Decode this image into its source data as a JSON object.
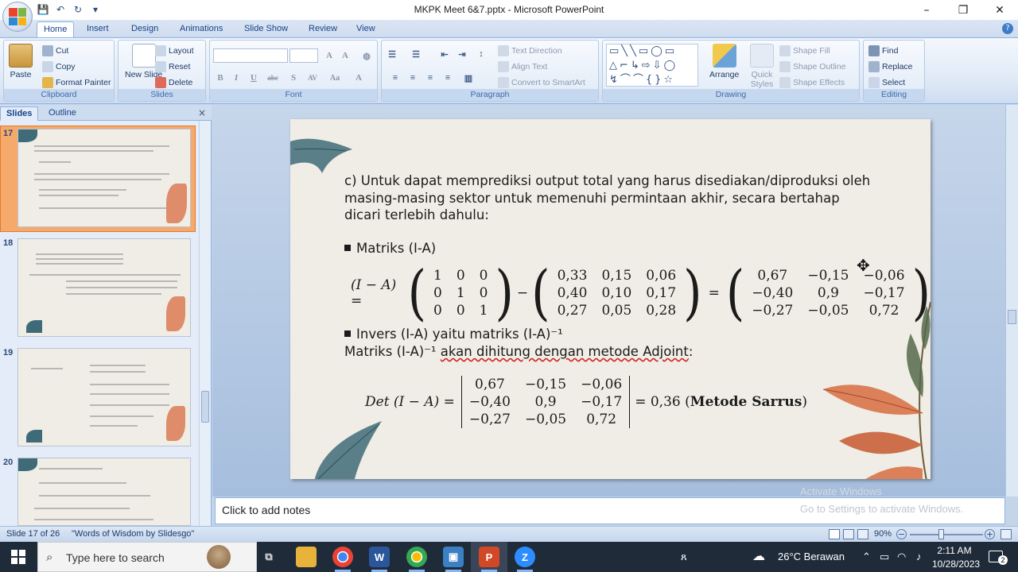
{
  "window": {
    "title": "MKPK Meet 6&7.pptx - Microsoft PowerPoint"
  },
  "tabs": [
    "Home",
    "Insert",
    "Design",
    "Animations",
    "Slide Show",
    "Review",
    "View"
  ],
  "ribbon": {
    "clipboard": {
      "label": "Clipboard",
      "paste": "Paste",
      "cut": "Cut",
      "copy": "Copy",
      "format_painter": "Format Painter"
    },
    "slides": {
      "label": "Slides",
      "new_slide": "New Slide",
      "layout": "Layout",
      "reset": "Reset",
      "delete": "Delete"
    },
    "font": {
      "label": "Font",
      "buttons": [
        "B",
        "I",
        "U",
        "abc",
        "S",
        "AV",
        "Aa",
        "A"
      ]
    },
    "paragraph": {
      "label": "Paragraph",
      "text_direction": "Text Direction",
      "align_text": "Align Text",
      "convert_smartart": "Convert to SmartArt"
    },
    "drawing": {
      "label": "Drawing",
      "arrange": "Arrange",
      "quick_styles": "Quick Styles",
      "shape_fill": "Shape Fill",
      "shape_outline": "Shape Outline",
      "shape_effects": "Shape Effects"
    },
    "editing": {
      "label": "Editing",
      "find": "Find",
      "replace": "Replace",
      "select": "Select"
    }
  },
  "panel": {
    "tabs": [
      "Slides",
      "Outline"
    ],
    "close": "×"
  },
  "thumbnails": [
    {
      "number": "17",
      "selected": true
    },
    {
      "number": "18",
      "selected": false
    },
    {
      "number": "19",
      "selected": false
    },
    {
      "number": "20",
      "selected": false
    }
  ],
  "slide": {
    "intro": [
      "c) Untuk dapat memprediksi output total yang harus disediakan/diproduksi oleh",
      "masing-masing sektor untuk memenuhi permintaan akhir, secara bertahap",
      "dicari terlebih dahulu:"
    ],
    "bullet1": "Matriks (I-A)",
    "eq1_lhs": "(I − A) =",
    "identity": [
      [
        "1",
        "0",
        "0"
      ],
      [
        "0",
        "1",
        "0"
      ],
      [
        "0",
        "0",
        "1"
      ]
    ],
    "minus": "−",
    "equals": "=",
    "matrix_a": [
      [
        "0,33",
        "0,15",
        "0,06"
      ],
      [
        "0,40",
        "0,10",
        "0,17"
      ],
      [
        "0,27",
        "0,05",
        "0,28"
      ]
    ],
    "matrix_ia": [
      [
        "0,67",
        "−0,15",
        "−0,06"
      ],
      [
        "−0,40",
        "0,9",
        "−0,17"
      ],
      [
        "−0,27",
        "−0,05",
        "0,72"
      ]
    ],
    "bullet2": "Invers (I-A) yaitu matriks (I-A)⁻¹",
    "line2_prefix": "Matriks (I-A)⁻¹ ",
    "line2_underlined": "akan dihitung dengan metode Adjoint",
    "line2_suffix": ":",
    "det_lhs": "Det (I − A) =",
    "det_matrix": [
      [
        "0,67",
        "−0,15",
        "−0,06"
      ],
      [
        "−0,40",
        "0,9",
        "−0,17"
      ],
      [
        "−0,27",
        "−0,05",
        "0,72"
      ]
    ],
    "det_result": "= 0,36 (",
    "det_method": "Metode Sarrus",
    "det_close": ")"
  },
  "notes": {
    "placeholder": "Click to add notes"
  },
  "watermark": {
    "line1": "Activate Windows",
    "line2": "Go to Settings to activate Windows."
  },
  "status": {
    "slide_info": "Slide 17 of 26",
    "theme": "\"Words of Wisdom by Slidesgo\"",
    "zoom": "90%"
  },
  "taskbar": {
    "search_placeholder": "Type here to search",
    "weather": "26°C  Berawan",
    "time": "2:11 AM",
    "date": "10/28/2023",
    "notifications": "2"
  },
  "colors": {
    "accent": "#2b579a",
    "slide_bg": "#efede5",
    "leaf_teal": "#3f6b78",
    "leaf_orange": "#d9734a"
  }
}
